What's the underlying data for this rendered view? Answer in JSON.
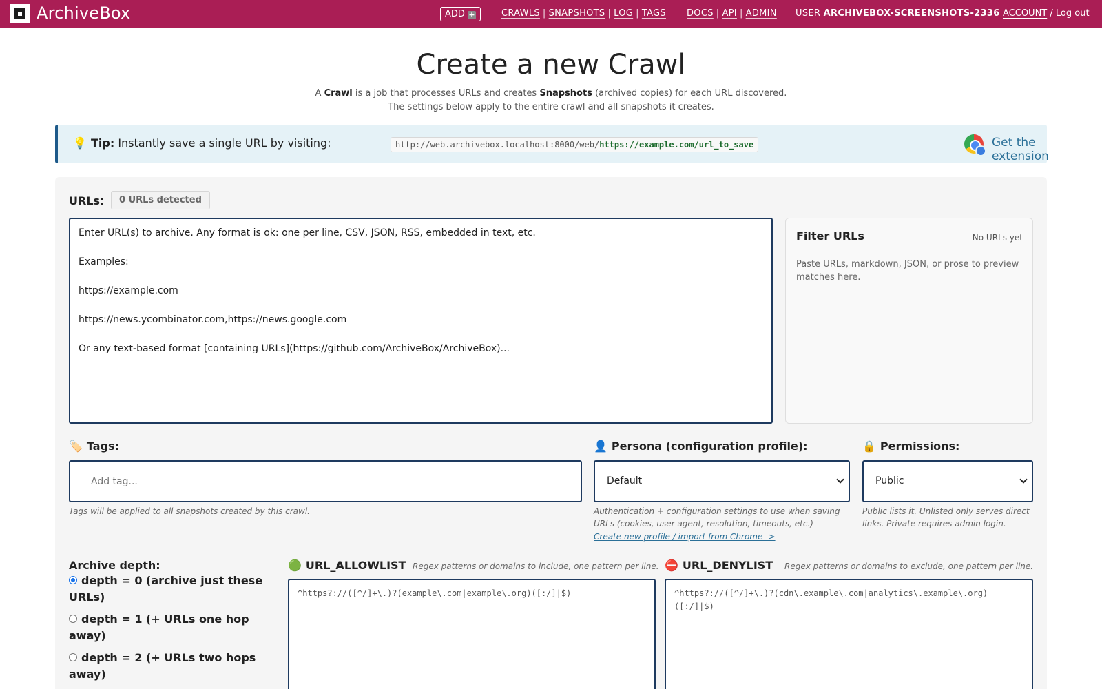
{
  "nav": {
    "brand": "ArchiveBox",
    "add_button": "ADD",
    "add_icon": "+",
    "links1": [
      "CRAWLS",
      "SNAPSHOTS",
      "LOG",
      "TAGS"
    ],
    "links2": [
      "DOCS",
      "API",
      "ADMIN"
    ],
    "user_prefix": "USER",
    "username": "ARCHIVEBOX-SCREENSHOTS-2336",
    "account_link": "ACCOUNT",
    "account_sep": "/",
    "logout_link": "Log out"
  },
  "header": {
    "title": "Create a new Crawl",
    "sub1_a": "A ",
    "sub1_crawl": "Crawl",
    "sub1_b": " is a job that processes URLs and creates ",
    "sub1_snapshots": "Snapshots",
    "sub1_c": " (archived copies) for each URL discovered.",
    "sub2": "The settings below apply to the entire crawl and all snapshots it creates."
  },
  "tip": {
    "bulb_icon": "💡",
    "label": "Tip:",
    "text": " Instantly save a single URL by visiting:",
    "code_prefix": "http://web.archivebox.localhost:8000/web/",
    "code_suffix": "https://example.com/url_to_save",
    "extension_link": "Get the extension"
  },
  "form": {
    "urls_label": "URLs:",
    "urls_badge": "0 URLs detected",
    "urls_placeholder": "Enter URL(s) to archive. Any format is ok: one per line, CSV, JSON, RSS, embedded in text, etc.\n\nExamples:\n\nhttps://example.com\n\nhttps://news.ycombinator.com,https://news.google.com\n\nOr any text-based format [containing URLs](https://github.com/ArchiveBox/ArchiveBox)...",
    "filter": {
      "title": "Filter URLs",
      "count": "No URLs yet",
      "hint": "Paste URLs, markdown, JSON, or prose to preview matches here."
    },
    "tags": {
      "icon": "🏷️",
      "label": "Tags:",
      "placeholder": "Add tag...",
      "help": "Tags will be applied to all snapshots created by this crawl."
    },
    "persona": {
      "icon": "👤",
      "label": "Persona (configuration profile):",
      "value": "Default",
      "help": "Authentication + configuration settings to use when saving URLs (cookies, user agent, resolution, timeouts, etc.)",
      "link": "Create new profile / import from Chrome ->"
    },
    "permissions": {
      "icon": "🔒",
      "label": "Permissions:",
      "value": "Public",
      "help": "Public lists it. Unlisted only serves direct links. Private requires admin login."
    },
    "depth": {
      "label": "Archive depth:",
      "options": [
        "depth = 0 (archive just these URLs)",
        "depth = 1 (+ URLs one hop away)",
        "depth = 2 (+ URLs two hops away)"
      ],
      "selected": 0
    },
    "allowlist": {
      "icon": "🟢",
      "label": "URL_ALLOWLIST",
      "hint": "Regex patterns or domains to include, one pattern per line.",
      "placeholder": "^https?://([^/]+\\.)?(example\\.com|example\\.org)([:/]|$)"
    },
    "denylist": {
      "icon": "⛔",
      "label": "URL_DENYLIST",
      "hint": "Regex patterns or domains to exclude, one pattern per line.",
      "placeholder": "^https?://([^/]+\\.)?(cdn\\.example\\.com|analytics\\.example\\.org)([:/]|$)"
    }
  }
}
